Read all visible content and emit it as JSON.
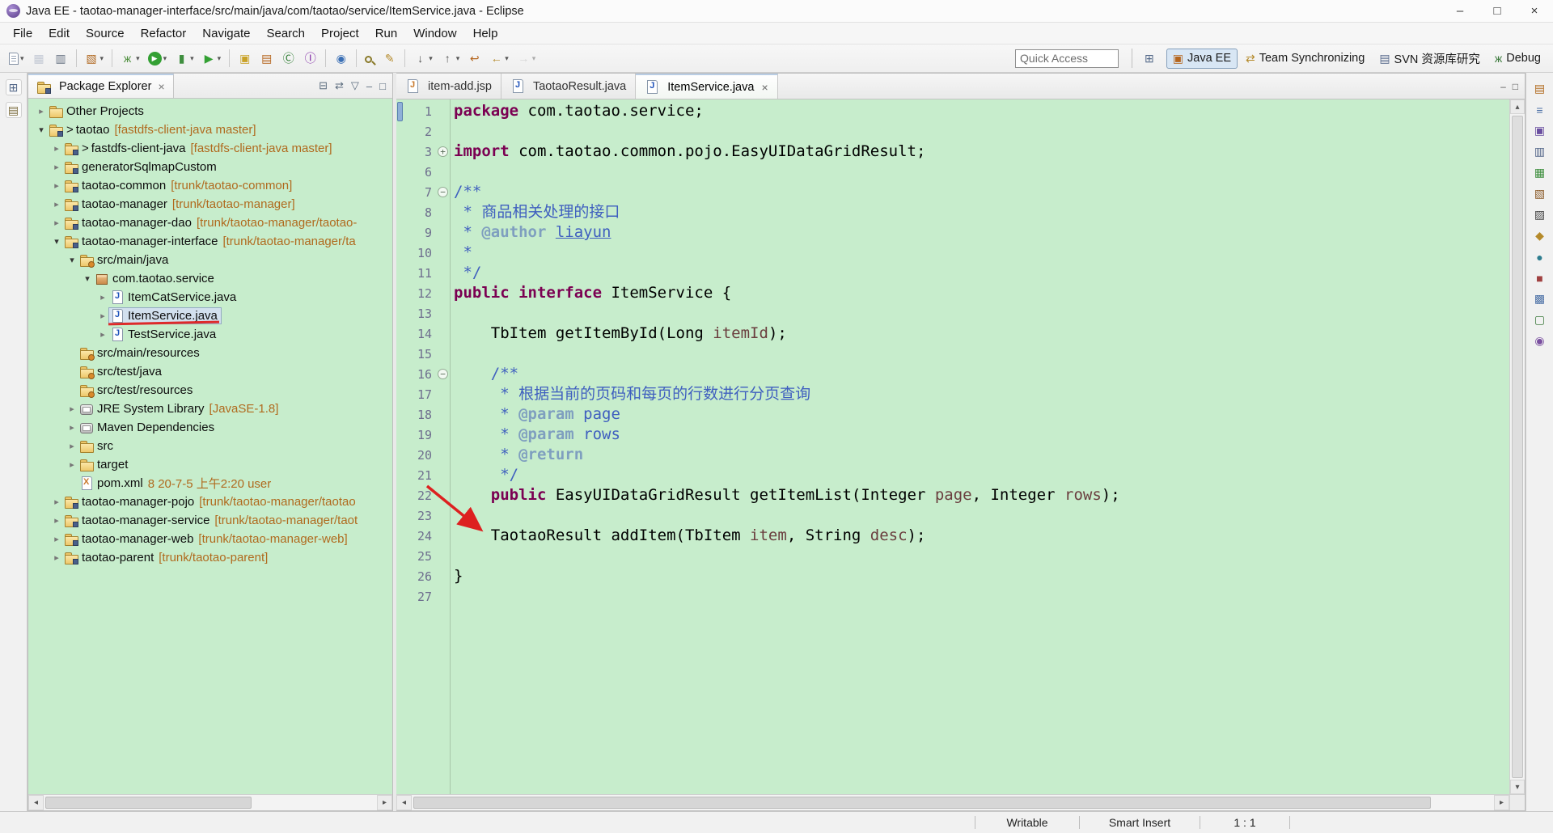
{
  "window": {
    "title": "Java EE - taotao-manager-interface/src/main/java/com/taotao/service/ItemService.java - Eclipse",
    "controls": [
      {
        "name": "minimize-button",
        "glyph": "–"
      },
      {
        "name": "maximize-button",
        "glyph": "□"
      },
      {
        "name": "close-button",
        "glyph": "×"
      }
    ]
  },
  "menu": [
    "File",
    "Edit",
    "Source",
    "Refactor",
    "Navigate",
    "Search",
    "Project",
    "Run",
    "Window",
    "Help"
  ],
  "icons": {
    "expanded_arrow": "▾",
    "collapsed_arrow": "▸",
    "dropdown_caret": "▾",
    "fold_collapsed": "+",
    "fold_expanded": "−",
    "close": "×",
    "scroll_left": "◂",
    "scroll_right": "▸",
    "scroll_up": "▴",
    "scroll_down": "▾",
    "view_menu": "▽",
    "collapse_all": "⊟",
    "link_editor": "⇄",
    "minimize_view": "–",
    "maximize_view": "□"
  },
  "toolbar": {
    "quick_access": "Quick Access",
    "buttons": [
      {
        "name": "new-wizard-button",
        "css": "page",
        "dropdown": true
      },
      {
        "name": "save-button",
        "glyph": "▦",
        "color": "#8a97b0",
        "disabled": true
      },
      {
        "name": "print-button",
        "glyph": "▥",
        "color": "#6a7585"
      },
      {
        "sep": true
      },
      {
        "name": "new-web-artifact-button",
        "glyph": "▧",
        "color": "#b06820",
        "dropdown": true
      },
      {
        "sep": true
      },
      {
        "name": "debug-button",
        "glyph": "ж",
        "color": "#4f8f3f",
        "dropdown": true
      },
      {
        "name": "run-button",
        "glyph": "▶",
        "color": "#ffffff",
        "bg": "#33a033",
        "dropdown": true
      },
      {
        "name": "coverage-button",
        "glyph": "▮",
        "color": "#3f8f3f",
        "dropdown": true
      },
      {
        "name": "external-tools-button",
        "glyph": "▶",
        "color": "#33a033",
        "dropdown": true
      },
      {
        "sep": true
      },
      {
        "name": "new-java-project-button",
        "glyph": "▣",
        "color": "#c9a227"
      },
      {
        "name": "new-package-button",
        "glyph": "▤",
        "color": "#b5651d"
      },
      {
        "name": "new-class-button",
        "glyph": "Ⓒ",
        "color": "#2e7d32"
      },
      {
        "name": "new-interface-button",
        "glyph": "Ⓘ",
        "color": "#7b1fa2"
      },
      {
        "sep": true
      },
      {
        "name": "open-web-browser-button",
        "glyph": "◉",
        "color": "#3a6fb5"
      },
      {
        "sep": true
      },
      {
        "name": "search-button",
        "css": "search"
      },
      {
        "name": "toggle-mark-occurrences-button",
        "glyph": "✎",
        "color": "#b58a2a"
      },
      {
        "sep": true
      },
      {
        "name": "next-annotation-button",
        "glyph": "↓",
        "color": "#555555",
        "dropdown": true
      },
      {
        "name": "previous-annotation-button",
        "glyph": "↑",
        "color": "#555555",
        "dropdown": true
      },
      {
        "name": "last-edit-location-button",
        "glyph": "↩",
        "color": "#b5651d"
      },
      {
        "name": "back-button",
        "glyph": "←",
        "color": "#b58a2a",
        "dropdown": true
      },
      {
        "name": "forward-button",
        "glyph": "→",
        "color": "#b0b0b0",
        "dropdown": true,
        "disabled": true
      }
    ],
    "perspective_bar": {
      "open_perspective": {
        "name": "open-perspective-button",
        "glyph": "⊞",
        "color": "#556a8a"
      },
      "perspectives": [
        {
          "name": "perspective-java-ee-button",
          "label": "Java EE",
          "glyph": "▣",
          "color": "#b5651d",
          "active": true
        },
        {
          "name": "perspective-team-synchronizing-button",
          "label": "Team Synchronizing",
          "glyph": "⇄",
          "color": "#b58a2a",
          "active": false
        },
        {
          "name": "perspective-svn-button",
          "label": "SVN 资源库研究",
          "glyph": "▤",
          "color": "#55678a",
          "active": false
        },
        {
          "name": "perspective-debug-button",
          "label": "Debug",
          "glyph": "ж",
          "color": "#3c7a3c",
          "active": false
        }
      ]
    }
  },
  "left_strip": [
    {
      "name": "restore-view-icon-1",
      "glyph": "⊞",
      "color": "#566a8a"
    },
    {
      "name": "restore-view-icon-2",
      "glyph": "▤",
      "color": "#7a6a3a"
    }
  ],
  "right_strip": [
    {
      "name": "snippets-view-icon",
      "glyph": "▤",
      "color": "#b06a1e"
    },
    {
      "name": "outline-view-icon",
      "glyph": "≡",
      "color": "#4a6fa5"
    },
    {
      "name": "task-list-view-icon",
      "glyph": "▣",
      "color": "#6a4fa0"
    },
    {
      "name": "properties-view-icon",
      "glyph": "▥",
      "color": "#55678a"
    },
    {
      "name": "servers-view-icon",
      "glyph": "▦",
      "color": "#3f8f3f"
    },
    {
      "name": "data-source-explorer-view-icon",
      "glyph": "▧",
      "color": "#8a5a28"
    },
    {
      "name": "console-view-icon",
      "glyph": "▨",
      "color": "#444444"
    },
    {
      "name": "search-view-icon",
      "glyph": "◆",
      "color": "#b58a2a"
    },
    {
      "name": "bookmarks-view-icon",
      "glyph": "●",
      "color": "#2e7d8f"
    },
    {
      "name": "problems-view-icon",
      "glyph": "■",
      "color": "#a04040"
    },
    {
      "name": "javadoc-view-icon",
      "glyph": "▩",
      "color": "#4a6fa5"
    },
    {
      "name": "declaration-view-icon",
      "glyph": "▢",
      "color": "#3c7a3c"
    },
    {
      "name": "history-view-icon",
      "glyph": "◉",
      "color": "#7a4fa0"
    }
  ],
  "package_explorer": {
    "title": "Package Explorer",
    "tools": [
      {
        "name": "collapse-all-icon",
        "glyph": "⊟"
      },
      {
        "name": "link-with-editor-icon",
        "glyph": "⇄"
      },
      {
        "name": "view-menu-icon",
        "glyph": "▽"
      },
      {
        "name": "minimize-view-icon",
        "glyph": "–"
      },
      {
        "name": "maximize-view-icon",
        "glyph": "□"
      }
    ],
    "tree": [
      {
        "label": "Other Projects",
        "lvl": 0,
        "icon": "wset",
        "arr": "c"
      },
      {
        "pre": ">",
        "label": "taotao",
        "dec": "[fastdfs-client-java master]",
        "lvl": 0,
        "icon": "proj",
        "arr": "e"
      },
      {
        "pre": ">",
        "label": "fastdfs-client-java",
        "dec": "[fastdfs-client-java master]",
        "lvl": 1,
        "icon": "proj",
        "arr": "c"
      },
      {
        "label": "generatorSqlmapCustom",
        "lvl": 1,
        "icon": "proj",
        "arr": "c"
      },
      {
        "label": "taotao-common",
        "dec": "[trunk/taotao-common]",
        "lvl": 1,
        "icon": "proj",
        "arr": "c"
      },
      {
        "label": "taotao-manager",
        "dec": "[trunk/taotao-manager]",
        "lvl": 1,
        "icon": "proj",
        "arr": "c"
      },
      {
        "label": "taotao-manager-dao",
        "dec": "[trunk/taotao-manager/taotao-",
        "lvl": 1,
        "icon": "proj",
        "arr": "c"
      },
      {
        "label": "taotao-manager-interface",
        "dec": "[trunk/taotao-manager/ta",
        "lvl": 1,
        "icon": "proj",
        "arr": "e"
      },
      {
        "label": "src/main/java",
        "lvl": 2,
        "icon": "srcf",
        "arr": "e"
      },
      {
        "label": "com.taotao.service",
        "lvl": 3,
        "icon": "pkg",
        "arr": "e"
      },
      {
        "label": "ItemCatService.java",
        "lvl": 4,
        "icon": "jfile",
        "arr": "c"
      },
      {
        "label": "ItemService.java",
        "lvl": 4,
        "icon": "jfile",
        "arr": "c",
        "sel": true,
        "ann": true
      },
      {
        "label": "TestService.java",
        "lvl": 4,
        "icon": "jfile",
        "arr": "c"
      },
      {
        "label": "src/main/resources",
        "lvl": 2,
        "icon": "srcf",
        "arr": ""
      },
      {
        "label": "src/test/java",
        "lvl": 2,
        "icon": "srcf",
        "arr": ""
      },
      {
        "label": "src/test/resources",
        "lvl": 2,
        "icon": "srcf",
        "arr": ""
      },
      {
        "label": "JRE System Library",
        "dec": "[JavaSE-1.8]",
        "lvl": 2,
        "icon": "lib",
        "arr": "c"
      },
      {
        "label": "Maven Dependencies",
        "lvl": 2,
        "icon": "lib",
        "arr": "c"
      },
      {
        "label": "src",
        "lvl": 2,
        "icon": "folder",
        "arr": "c"
      },
      {
        "label": "target",
        "lvl": 2,
        "icon": "folder",
        "arr": "c"
      },
      {
        "label": "pom.xml",
        "dec": "8 20-7-5 上午2:20 user",
        "lvl": 2,
        "icon": "xml",
        "arr": ""
      },
      {
        "label": "taotao-manager-pojo",
        "dec": "[trunk/taotao-manager/taotao",
        "lvl": 1,
        "icon": "proj",
        "arr": "c"
      },
      {
        "label": "taotao-manager-service",
        "dec": "[trunk/taotao-manager/taot",
        "lvl": 1,
        "icon": "proj",
        "arr": "c"
      },
      {
        "label": "taotao-manager-web",
        "dec": "[trunk/taotao-manager-web]",
        "lvl": 1,
        "icon": "proj",
        "arr": "c"
      },
      {
        "label": "taotao-parent",
        "dec": "[trunk/taotao-parent]",
        "lvl": 1,
        "icon": "proj",
        "arr": "c"
      }
    ]
  },
  "editor": {
    "tabs": [
      {
        "name": "tab-item-add-jsp",
        "label": "item-add.jsp",
        "icon": "jsp",
        "active": false
      },
      {
        "name": "tab-taotaoresult-java",
        "label": "TaotaoResult.java",
        "icon": "jfile",
        "active": false
      },
      {
        "name": "tab-itemservice-java",
        "label": "ItemService.java",
        "icon": "jfile",
        "active": true
      }
    ],
    "lines": [
      {
        "n": "1",
        "t": [
          [
            "k",
            "package "
          ],
          [
            "d",
            "com.taotao.service;"
          ]
        ]
      },
      {
        "n": "2",
        "t": []
      },
      {
        "n": "3",
        "fold": "plus",
        "t": [
          [
            "k",
            "import "
          ],
          [
            "d",
            "com.taotao.common.pojo.EasyUIDataGridResult;"
          ]
        ]
      },
      {
        "n": "6",
        "t": []
      },
      {
        "n": "7",
        "fold": "minus",
        "t": [
          [
            "j",
            "/**"
          ]
        ]
      },
      {
        "n": "8",
        "t": [
          [
            "j",
            " * 商品相关处理的接口"
          ]
        ]
      },
      {
        "n": "9",
        "t": [
          [
            "j",
            " * "
          ],
          [
            "jt",
            "@author"
          ],
          [
            "j",
            " "
          ],
          [
            "jl",
            "liayun"
          ]
        ]
      },
      {
        "n": "10",
        "t": [
          [
            "j",
            " * "
          ]
        ]
      },
      {
        "n": "11",
        "t": [
          [
            "j",
            " */"
          ]
        ]
      },
      {
        "n": "12",
        "t": [
          [
            "k",
            "public interface "
          ],
          [
            "d",
            "ItemService {"
          ]
        ]
      },
      {
        "n": "13",
        "t": []
      },
      {
        "n": "14",
        "t": [
          [
            "d",
            "    TbItem getItemById(Long "
          ],
          [
            "p",
            "itemId"
          ],
          [
            "d",
            ");"
          ]
        ]
      },
      {
        "n": "15",
        "t": []
      },
      {
        "n": "16",
        "fold": "minus",
        "t": [
          [
            "j",
            "    /**"
          ]
        ]
      },
      {
        "n": "17",
        "t": [
          [
            "j",
            "     * 根据当前的页码和每页的行数进行分页查询"
          ]
        ]
      },
      {
        "n": "18",
        "t": [
          [
            "j",
            "     * "
          ],
          [
            "jt",
            "@param"
          ],
          [
            "j",
            " page"
          ]
        ]
      },
      {
        "n": "19",
        "t": [
          [
            "j",
            "     * "
          ],
          [
            "jt",
            "@param"
          ],
          [
            "j",
            " rows"
          ]
        ]
      },
      {
        "n": "20",
        "t": [
          [
            "j",
            "     * "
          ],
          [
            "jt",
            "@return"
          ]
        ]
      },
      {
        "n": "21",
        "t": [
          [
            "j",
            "     */"
          ]
        ]
      },
      {
        "n": "22",
        "t": [
          [
            "d",
            "    "
          ],
          [
            "k",
            "public "
          ],
          [
            "d",
            "EasyUIDataGridResult getItemList(Integer "
          ],
          [
            "p",
            "page"
          ],
          [
            "d",
            ", Integer "
          ],
          [
            "p",
            "rows"
          ],
          [
            "d",
            ");"
          ]
        ]
      },
      {
        "n": "23",
        "t": []
      },
      {
        "n": "24",
        "t": [
          [
            "d",
            "    TaotaoResult addItem(TbItem "
          ],
          [
            "p",
            "item"
          ],
          [
            "d",
            ", String "
          ],
          [
            "p",
            "desc"
          ],
          [
            "d",
            ");"
          ]
        ]
      },
      {
        "n": "25",
        "t": []
      },
      {
        "n": "26",
        "t": [
          [
            "d",
            "}"
          ]
        ]
      },
      {
        "n": "27",
        "t": []
      }
    ]
  },
  "status_bar": {
    "writable": "Writable",
    "insert_mode": "Smart Insert",
    "cursor_position": "1 : 1"
  },
  "colors": {
    "editor_bg": "#c7edcc",
    "keyword": "#7B0052",
    "javadoc": "#3F5FBF",
    "annotation_red": "#dd2a2a"
  }
}
